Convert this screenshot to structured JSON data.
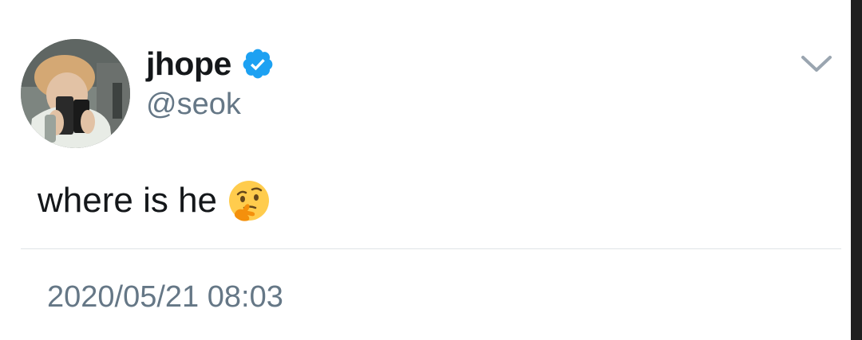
{
  "user": {
    "display_name": "jhope",
    "handle": "@seok",
    "verified": true
  },
  "tweet": {
    "text": "where is he",
    "emoji": "thinking-face",
    "timestamp": "2020/05/21 08:03"
  },
  "icons": {
    "verified": "verified-badge-icon",
    "menu": "chevron-down-icon",
    "emoji": "thinking-face-emoji-icon"
  },
  "colors": {
    "verified_blue": "#1da1f2",
    "secondary_text": "#657786",
    "primary_text": "#14171a",
    "divider": "#dfe3e6"
  }
}
